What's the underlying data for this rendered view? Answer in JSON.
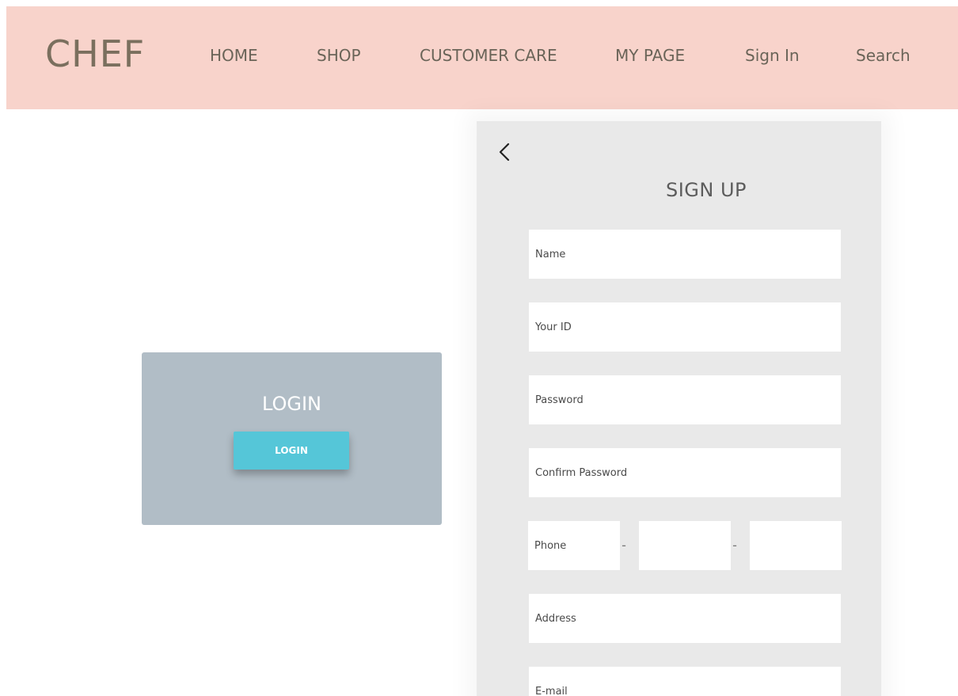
{
  "header": {
    "logo": "CHEF",
    "nav": {
      "home": "HOME",
      "shop": "SHOP",
      "customer_care": "CUSTOMER CARE",
      "my_page": "MY PAGE",
      "sign_in": "Sign In",
      "search": "Search"
    },
    "background_color": "#f8d3cb"
  },
  "login_card": {
    "title": "LOGIN",
    "button_label": "LOGIN",
    "background_color": "#b1bdc6",
    "button_color": "#55c6d8"
  },
  "signup": {
    "back_icon": "chevron-left-icon",
    "title": "SIGN UP",
    "fields": {
      "name": {
        "placeholder": "Name",
        "value": ""
      },
      "user_id": {
        "placeholder": "Your ID",
        "value": ""
      },
      "password": {
        "placeholder": "Password",
        "value": ""
      },
      "confirm_password": {
        "placeholder": "Confirm Password",
        "value": ""
      },
      "phone_1": {
        "placeholder": "Phone",
        "value": ""
      },
      "phone_2": {
        "placeholder": "",
        "value": ""
      },
      "phone_3": {
        "placeholder": "",
        "value": ""
      },
      "address": {
        "placeholder": "Address",
        "value": ""
      },
      "email": {
        "placeholder": "E-mail",
        "value": ""
      }
    },
    "phone_separator": "-",
    "background_color": "#e9e9e9"
  }
}
